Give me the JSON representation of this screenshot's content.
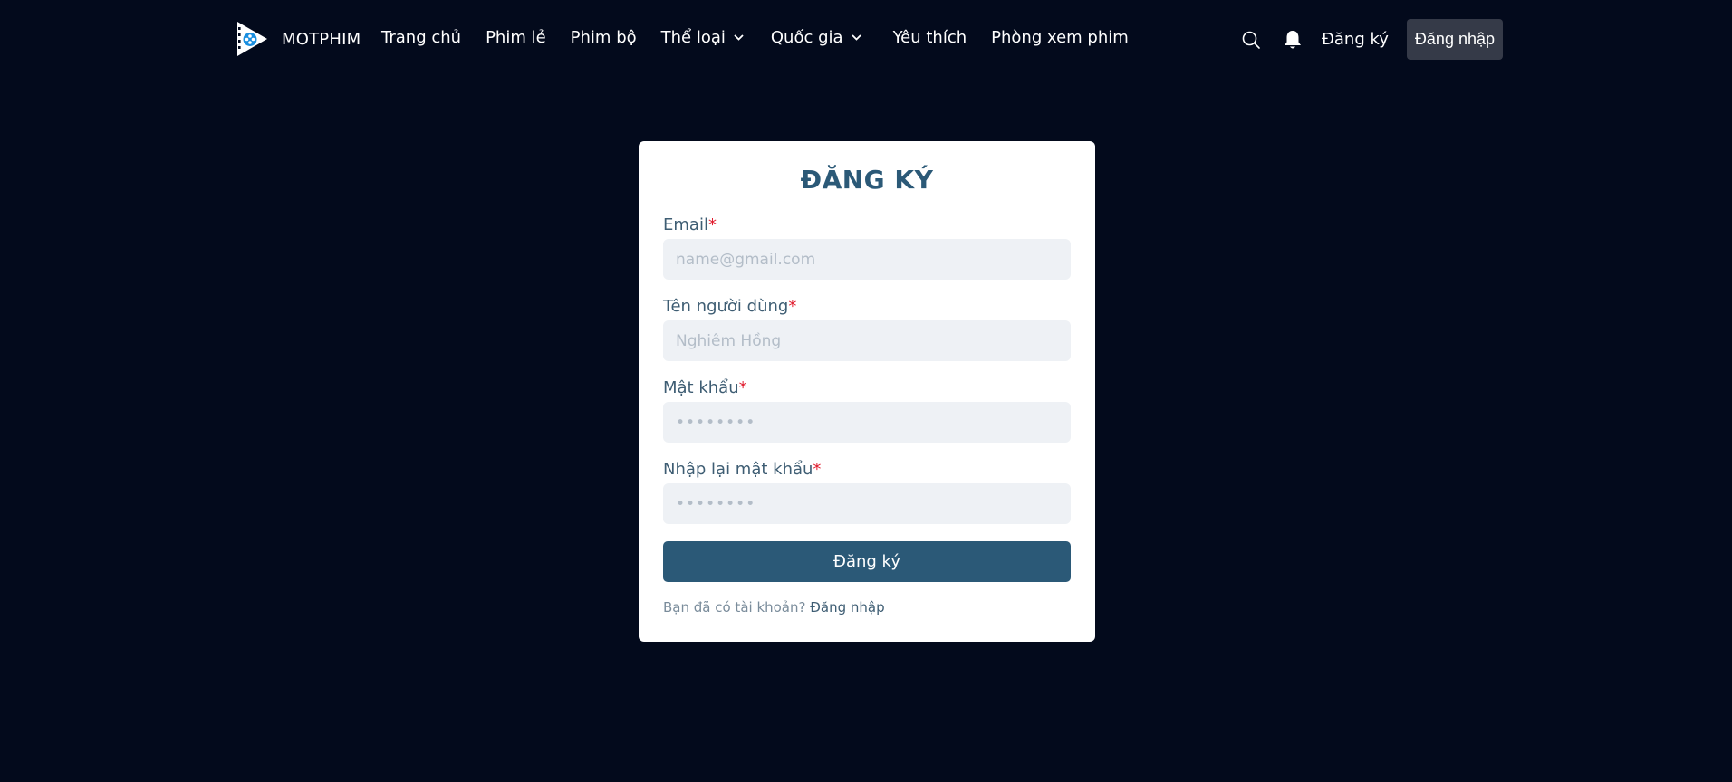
{
  "header": {
    "logo_text": "MOTPHIM",
    "nav": {
      "home": "Trang chủ",
      "movies": "Phim lẻ",
      "series": "Phim bộ",
      "genres": "Thể loại",
      "countries": "Quốc gia",
      "favorites": "Yêu thích",
      "watch_room": "Phòng xem phim"
    },
    "register_label": "Đăng ký",
    "login_label": "Đăng nhập"
  },
  "form": {
    "title": "ĐĂNG KÝ",
    "required_mark": "*",
    "email": {
      "label": "Email",
      "placeholder": "name@gmail.com",
      "value": ""
    },
    "username": {
      "label": "Tên người dùng",
      "placeholder": "Nghiêm Hồng",
      "value": ""
    },
    "password": {
      "label": "Mật khẩu",
      "placeholder": "••••••••",
      "value": ""
    },
    "confirm_password": {
      "label": "Nhập lại mật khẩu",
      "placeholder": "••••••••",
      "value": ""
    },
    "submit_label": "Đăng ký",
    "footer_text": "Bạn đã có tài khoản?",
    "footer_link": "Đăng nhập"
  },
  "colors": {
    "background": "#030a1c",
    "accent": "#2b5977",
    "required": "#e11d2f",
    "logo_blue": "#1a8fe0"
  },
  "icons": {
    "logo": "play-film-icon",
    "search": "search-icon",
    "notifications": "bell-icon",
    "dropdown": "chevron-down-icon"
  }
}
